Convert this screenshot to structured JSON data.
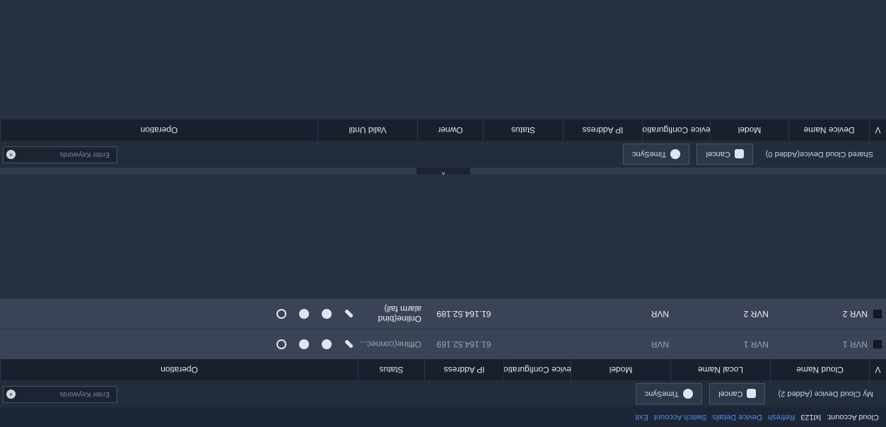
{
  "footer": {
    "cloud_account_label": "Cloud Account:",
    "cloud_account_value": "lxl123",
    "links": [
      "Refresh",
      "Device Details",
      "Switch Account",
      "Exit"
    ]
  },
  "my_cloud": {
    "title": "My Cloud Device (Added 2)",
    "cancel_label": "Cancel",
    "timesync_label": "TimeSync",
    "search_placeholder": "Enter Keywords",
    "columns": [
      "V",
      "Cloud Name",
      "Local Name",
      "Model",
      "evice Configuratio",
      "IP Address",
      "Status",
      "Operation"
    ],
    "rows": [
      {
        "cloud_name": "NVR 1",
        "local_name": "NVR 1",
        "model": "NVR",
        "ip": "61.164.52.169",
        "status": "Offline(connec...",
        "status2": ""
      },
      {
        "cloud_name": "NVR 2",
        "local_name": "NVR 2",
        "model": "NVR",
        "ip": "61.164.52.189",
        "status": "Online(bind",
        "status2": "alarm fail)"
      }
    ]
  },
  "shared_cloud": {
    "title": "Shared Cloud Device(Added 0)",
    "cancel_label": "Cancel",
    "timesync_label": "TimeSync",
    "search_placeholder": "Enter Keywords",
    "columns": [
      "V",
      "Device Name",
      "Model",
      "evice Configuratio",
      "IP Address",
      "Status",
      "Owner",
      "Valid Until",
      "Operation"
    ]
  },
  "collapse_glyph": "^",
  "icons": {
    "edit": "pencil-icon",
    "config": "gear-icon",
    "globe": "globe-icon",
    "refresh": "refresh-icon"
  },
  "colors": {
    "background": "#263040",
    "header": "#18202d",
    "row": "#3a4456",
    "link": "#4f8fe0"
  }
}
